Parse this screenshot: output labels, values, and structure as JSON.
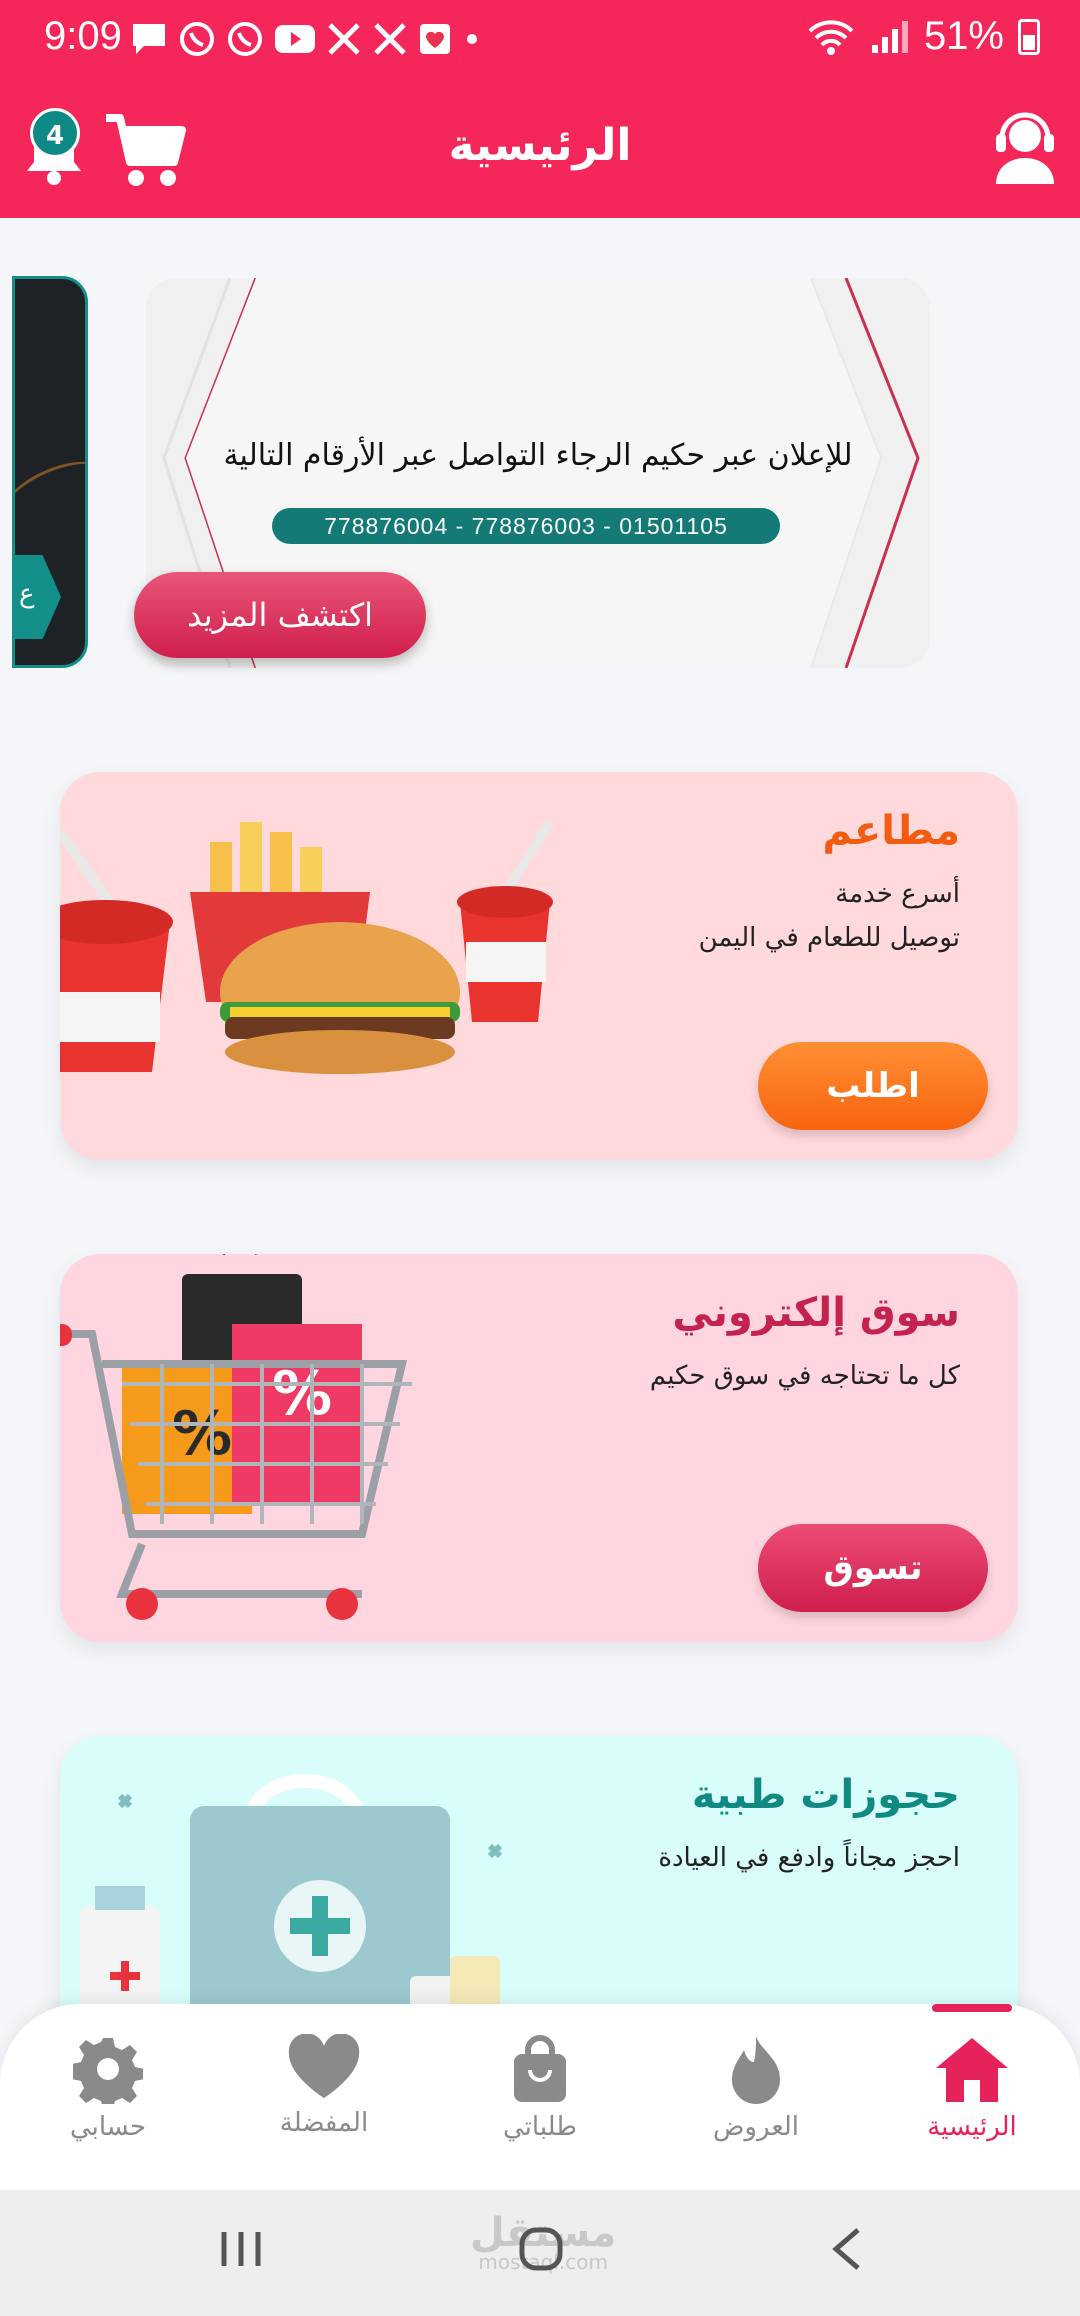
{
  "status_bar": {
    "time": "9:09",
    "battery": "51%",
    "notification_icons": [
      "message-icon",
      "whatsapp-icon",
      "whatsapp-icon",
      "youtube-icon",
      "x-icon",
      "x-icon",
      "app-icon"
    ]
  },
  "header": {
    "title": "الرئيسية",
    "notification_count": "4"
  },
  "banner": {
    "text": "للإعلان عبر حكيم الرجاء التواصل عبر الأرقام التالية",
    "phones": "778876004 - 778876003 - 01501105",
    "button_label": "اكتشف المزيد",
    "side_card_letter": "ع"
  },
  "cards": [
    {
      "title": "مطاعم",
      "desc_line1": "أسرع خدمة",
      "desc_line2": "توصيل للطعام في اليمن",
      "button": "اطلب"
    },
    {
      "title": "سوق إلكتروني",
      "desc_line1": "كل ما تحتاجه في سوق حكيم",
      "button": "تسوق"
    },
    {
      "title": "حجوزات طبية",
      "desc_line1": "احجز مجاناً وادفع في العيادة"
    }
  ],
  "bottom_nav": [
    {
      "label": "حسابي",
      "icon": "gear-icon"
    },
    {
      "label": "المفضلة",
      "icon": "heart-icon"
    },
    {
      "label": "طلباتي",
      "icon": "shopping-bag-icon"
    },
    {
      "label": "العروض",
      "icon": "flame-icon"
    },
    {
      "label": "الرئيسية",
      "icon": "home-icon",
      "active": true
    }
  ],
  "watermark": {
    "text": "مستقل",
    "sub": "mostaql.com"
  },
  "colors": {
    "brand": "#f5265a",
    "accent_teal": "#0e8a86",
    "orange": "#f86410"
  }
}
